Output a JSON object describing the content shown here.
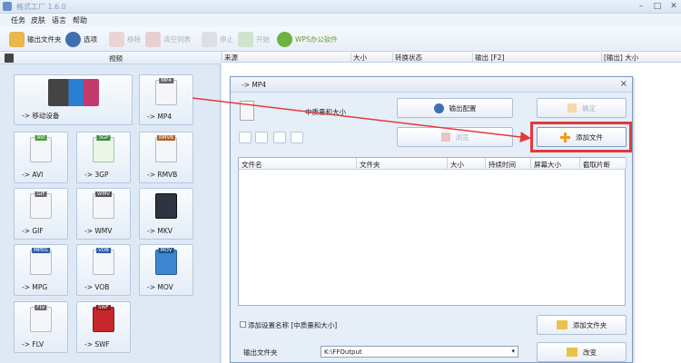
{
  "window": {
    "title": "格式工厂 1.6.0"
  },
  "menu": [
    "任务",
    "皮肤",
    "语言",
    "帮助"
  ],
  "toolbar": {
    "output_folder": "输出文件夹",
    "options": "选项",
    "remove": "移除",
    "clear_list": "清空列表",
    "stop": "停止",
    "start": "开始",
    "wps": "WPS办公软件"
  },
  "left_panel": {
    "header": "视频",
    "tiles": [
      "-> 移动设备",
      "-> MP4",
      "-> AVI",
      "-> 3GP",
      "-> RMVB",
      "-> GIF",
      "-> WMV",
      "-> MKV",
      "-> MPG",
      "-> VOB",
      "-> MOV",
      "-> FLV",
      "-> SWF"
    ],
    "tags": {
      "mp4": "MP4",
      "avi": "AVI",
      "gp": "3GP",
      "rmvb": "RMVB",
      "gif": "GIF",
      "wmv": "WMV",
      "mpeg": "MPEG",
      "vob": "VOB",
      "mov": "MOV",
      "flv": "FLV",
      "swf": "SWF"
    }
  },
  "columns": [
    "来源",
    "大小",
    "转换状态",
    "输出 [F2]",
    "[输出] 大小"
  ],
  "dialog": {
    "title": "-> MP4",
    "quality_label": "中质量和大小",
    "output_config": "输出配置",
    "ok": "确定",
    "browse": "浏览",
    "add_file": "添加文件",
    "table_headers": [
      "文件名",
      "文件夹",
      "大小",
      "持续时间",
      "屏幕大小",
      "截取片断"
    ],
    "add_setting_name": "添加设置名称 [中质量和大小]",
    "add_folder": "添加文件夹",
    "output_folder_label": "输出文件夹",
    "output_path": "K:\\FFOutput",
    "change": "改变"
  },
  "colors": {
    "annotation": "#e23a3a",
    "accent_orange": "#f39a1e"
  }
}
